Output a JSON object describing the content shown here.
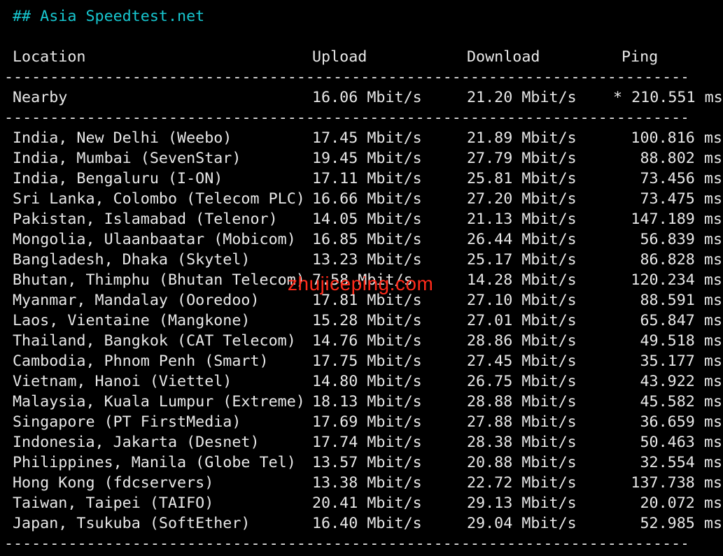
{
  "heading": "## Asia Speedtest.net",
  "columns": {
    "location": "Location",
    "upload": "Upload",
    "download": "Download",
    "ping": "Ping"
  },
  "divider": "------------------------------------------------------------------------------",
  "nearby": {
    "location": "Nearby",
    "upload": "16.06 Mbit/s",
    "download": "21.20 Mbit/s",
    "ping": "* 210.551 ms"
  },
  "rows": [
    {
      "location": "India, New Delhi (Weebo)",
      "upload": "17.45 Mbit/s",
      "download": "21.89 Mbit/s",
      "ping": "100.816 ms"
    },
    {
      "location": "India, Mumbai (SevenStar)",
      "upload": "19.45 Mbit/s",
      "download": "27.79 Mbit/s",
      "ping": "88.802 ms"
    },
    {
      "location": "India, Bengaluru (I-ON)",
      "upload": "17.11 Mbit/s",
      "download": "25.81 Mbit/s",
      "ping": "73.456 ms"
    },
    {
      "location": "Sri Lanka, Colombo (Telecom PLC)",
      "upload": "16.66 Mbit/s",
      "download": "27.20 Mbit/s",
      "ping": "73.475 ms"
    },
    {
      "location": "Pakistan, Islamabad (Telenor)",
      "upload": "14.05 Mbit/s",
      "download": "21.13 Mbit/s",
      "ping": "147.189 ms"
    },
    {
      "location": "Mongolia, Ulaanbaatar (Mobicom)",
      "upload": "16.85 Mbit/s",
      "download": "26.44 Mbit/s",
      "ping": "56.839 ms"
    },
    {
      "location": "Bangladesh, Dhaka (Skytel)",
      "upload": "13.23 Mbit/s",
      "download": "25.17 Mbit/s",
      "ping": "86.828 ms"
    },
    {
      "location": "Bhutan, Thimphu (Bhutan Telecom)",
      "upload": "7.58 Mbit/s",
      "download": "14.28 Mbit/s",
      "ping": "120.234 ms"
    },
    {
      "location": "Myanmar, Mandalay (Ooredoo)",
      "upload": "17.81 Mbit/s",
      "download": "27.10 Mbit/s",
      "ping": "88.591 ms"
    },
    {
      "location": "Laos, Vientaine (Mangkone)",
      "upload": "15.28 Mbit/s",
      "download": "27.01 Mbit/s",
      "ping": "65.847 ms"
    },
    {
      "location": "Thailand, Bangkok (CAT Telecom)",
      "upload": "14.76 Mbit/s",
      "download": "28.86 Mbit/s",
      "ping": "49.518 ms"
    },
    {
      "location": "Cambodia, Phnom Penh (Smart)",
      "upload": "17.75 Mbit/s",
      "download": "27.45 Mbit/s",
      "ping": "35.177 ms"
    },
    {
      "location": "Vietnam, Hanoi (Viettel)",
      "upload": "14.80 Mbit/s",
      "download": "26.75 Mbit/s",
      "ping": "43.922 ms"
    },
    {
      "location": "Malaysia, Kuala Lumpur (Extreme)",
      "upload": "18.13 Mbit/s",
      "download": "28.88 Mbit/s",
      "ping": "45.582 ms"
    },
    {
      "location": "Singapore (PT FirstMedia)",
      "upload": "17.69 Mbit/s",
      "download": "27.88 Mbit/s",
      "ping": "36.659 ms"
    },
    {
      "location": "Indonesia, Jakarta (Desnet)",
      "upload": "17.74 Mbit/s",
      "download": "28.38 Mbit/s",
      "ping": "50.463 ms"
    },
    {
      "location": "Philippines, Manila (Globe Tel)",
      "upload": "13.57 Mbit/s",
      "download": "20.88 Mbit/s",
      "ping": "32.554 ms"
    },
    {
      "location": "Hong Kong (fdcservers)",
      "upload": "13.38 Mbit/s",
      "download": "22.72 Mbit/s",
      "ping": "137.738 ms"
    },
    {
      "location": "Taiwan, Taipei (TAIFO)",
      "upload": "20.41 Mbit/s",
      "download": "29.13 Mbit/s",
      "ping": "20.072 ms"
    },
    {
      "location": "Japan, Tsukuba (SoftEther)",
      "upload": "16.40 Mbit/s",
      "download": "29.04 Mbit/s",
      "ping": "52.985 ms"
    }
  ],
  "watermark": "zhujiceping.com",
  "colors": {
    "background": "#000000",
    "text": "#e8e8e8",
    "heading": "#17c7d0",
    "watermark": "#ff2a1a"
  }
}
